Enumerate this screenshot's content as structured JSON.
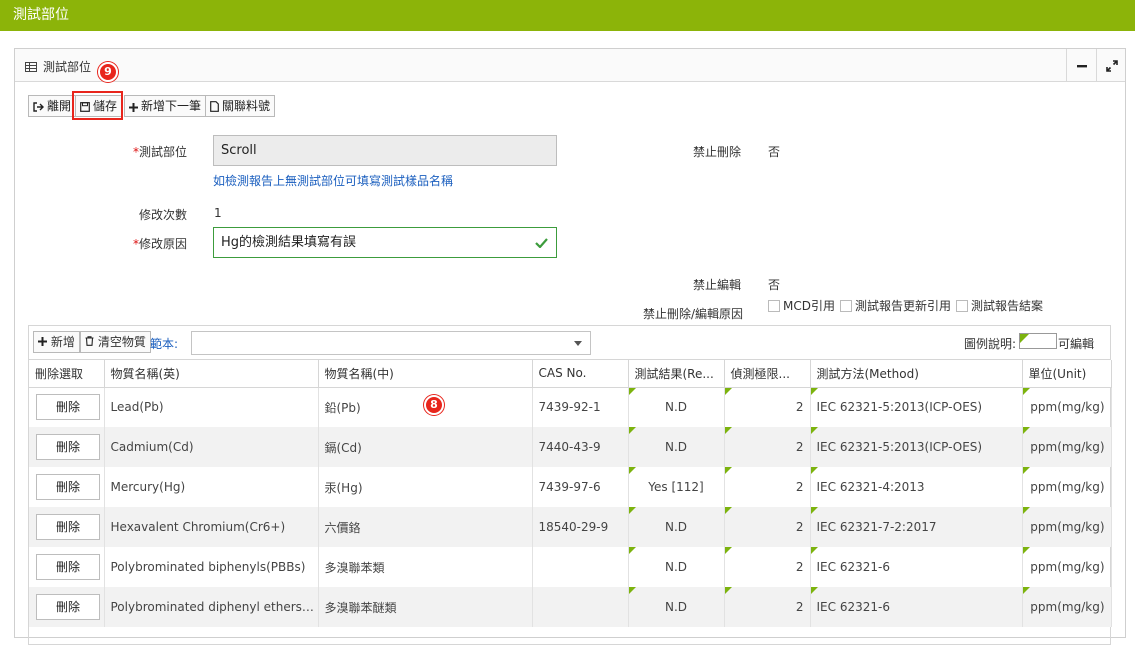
{
  "page_title": "測試部位",
  "panel": {
    "title": "測試部位"
  },
  "badges": {
    "save": "9",
    "grid": "8"
  },
  "toolbar": {
    "leave": "離開",
    "save": "儲存",
    "add_next": "新增下一筆",
    "related": "關聯料號"
  },
  "form": {
    "part_label": "測試部位",
    "part_value": "Scroll",
    "part_hint": "如檢測報告上無測試部位可填寫測試樣品名稱",
    "revise_count_label": "修改次數",
    "revise_count_value": "1",
    "revise_reason_label": "修改原因",
    "revise_reason_value": "Hg的檢測結果填寫有誤",
    "no_delete_label": "禁止刪除",
    "no_delete_value": "否",
    "no_edit_label": "禁止編輯",
    "no_edit_value": "否",
    "no_reason_label": "禁止刪除/編輯原因",
    "reasons": [
      "MCD引用",
      "測試報告更新引用",
      "測試報告結案"
    ]
  },
  "grid": {
    "add": "新增",
    "clear": "清空物質",
    "template_label": "範本:",
    "legend_label": "圖例說明:",
    "legend_editable": "可編輯",
    "columns": [
      "刪除選取",
      "物質名稱(英)",
      "物質名稱(中)",
      "CAS No.",
      "測試結果(Re...",
      "偵測極限...",
      "測試方法(Method)",
      "單位(Unit)"
    ],
    "delete_label": "刪除",
    "rows": [
      {
        "en": "Lead(Pb)",
        "zh": "鉛(Pb)",
        "cas": "7439-92-1",
        "result": "N.D",
        "limit": "2",
        "method": "IEC 62321-5:2013(ICP-OES)",
        "unit": "ppm(mg/kg)"
      },
      {
        "en": "Cadmium(Cd)",
        "zh": "鎘(Cd)",
        "cas": "7440-43-9",
        "result": "N.D",
        "limit": "2",
        "method": "IEC 62321-5:2013(ICP-OES)",
        "unit": "ppm(mg/kg)"
      },
      {
        "en": "Mercury(Hg)",
        "zh": "汞(Hg)",
        "cas": "7439-97-6",
        "result": "Yes [112]",
        "limit": "2",
        "method": "IEC 62321-4:2013",
        "unit": "ppm(mg/kg)"
      },
      {
        "en": "Hexavalent Chromium(Cr6+)",
        "zh": "六價鉻",
        "cas": "18540-29-9",
        "result": "N.D",
        "limit": "2",
        "method": "IEC 62321-7-2:2017",
        "unit": "ppm(mg/kg)"
      },
      {
        "en": "Polybrominated biphenyls(PBBs)",
        "zh": "多溴聯苯類",
        "cas": "",
        "result": "N.D",
        "limit": "2",
        "method": "IEC 62321-6",
        "unit": "ppm(mg/kg)"
      },
      {
        "en": "Polybrominated diphenyl ethers(P...",
        "zh": "多溴聯苯醚類",
        "cas": "",
        "result": "N.D",
        "limit": "2",
        "method": "IEC 62321-6",
        "unit": "ppm(mg/kg)"
      }
    ]
  },
  "colors": {
    "accent": "#8cb409",
    "badge": "#e8251c",
    "link": "#1b5fbf",
    "editable_marker": "#7cb30e"
  }
}
